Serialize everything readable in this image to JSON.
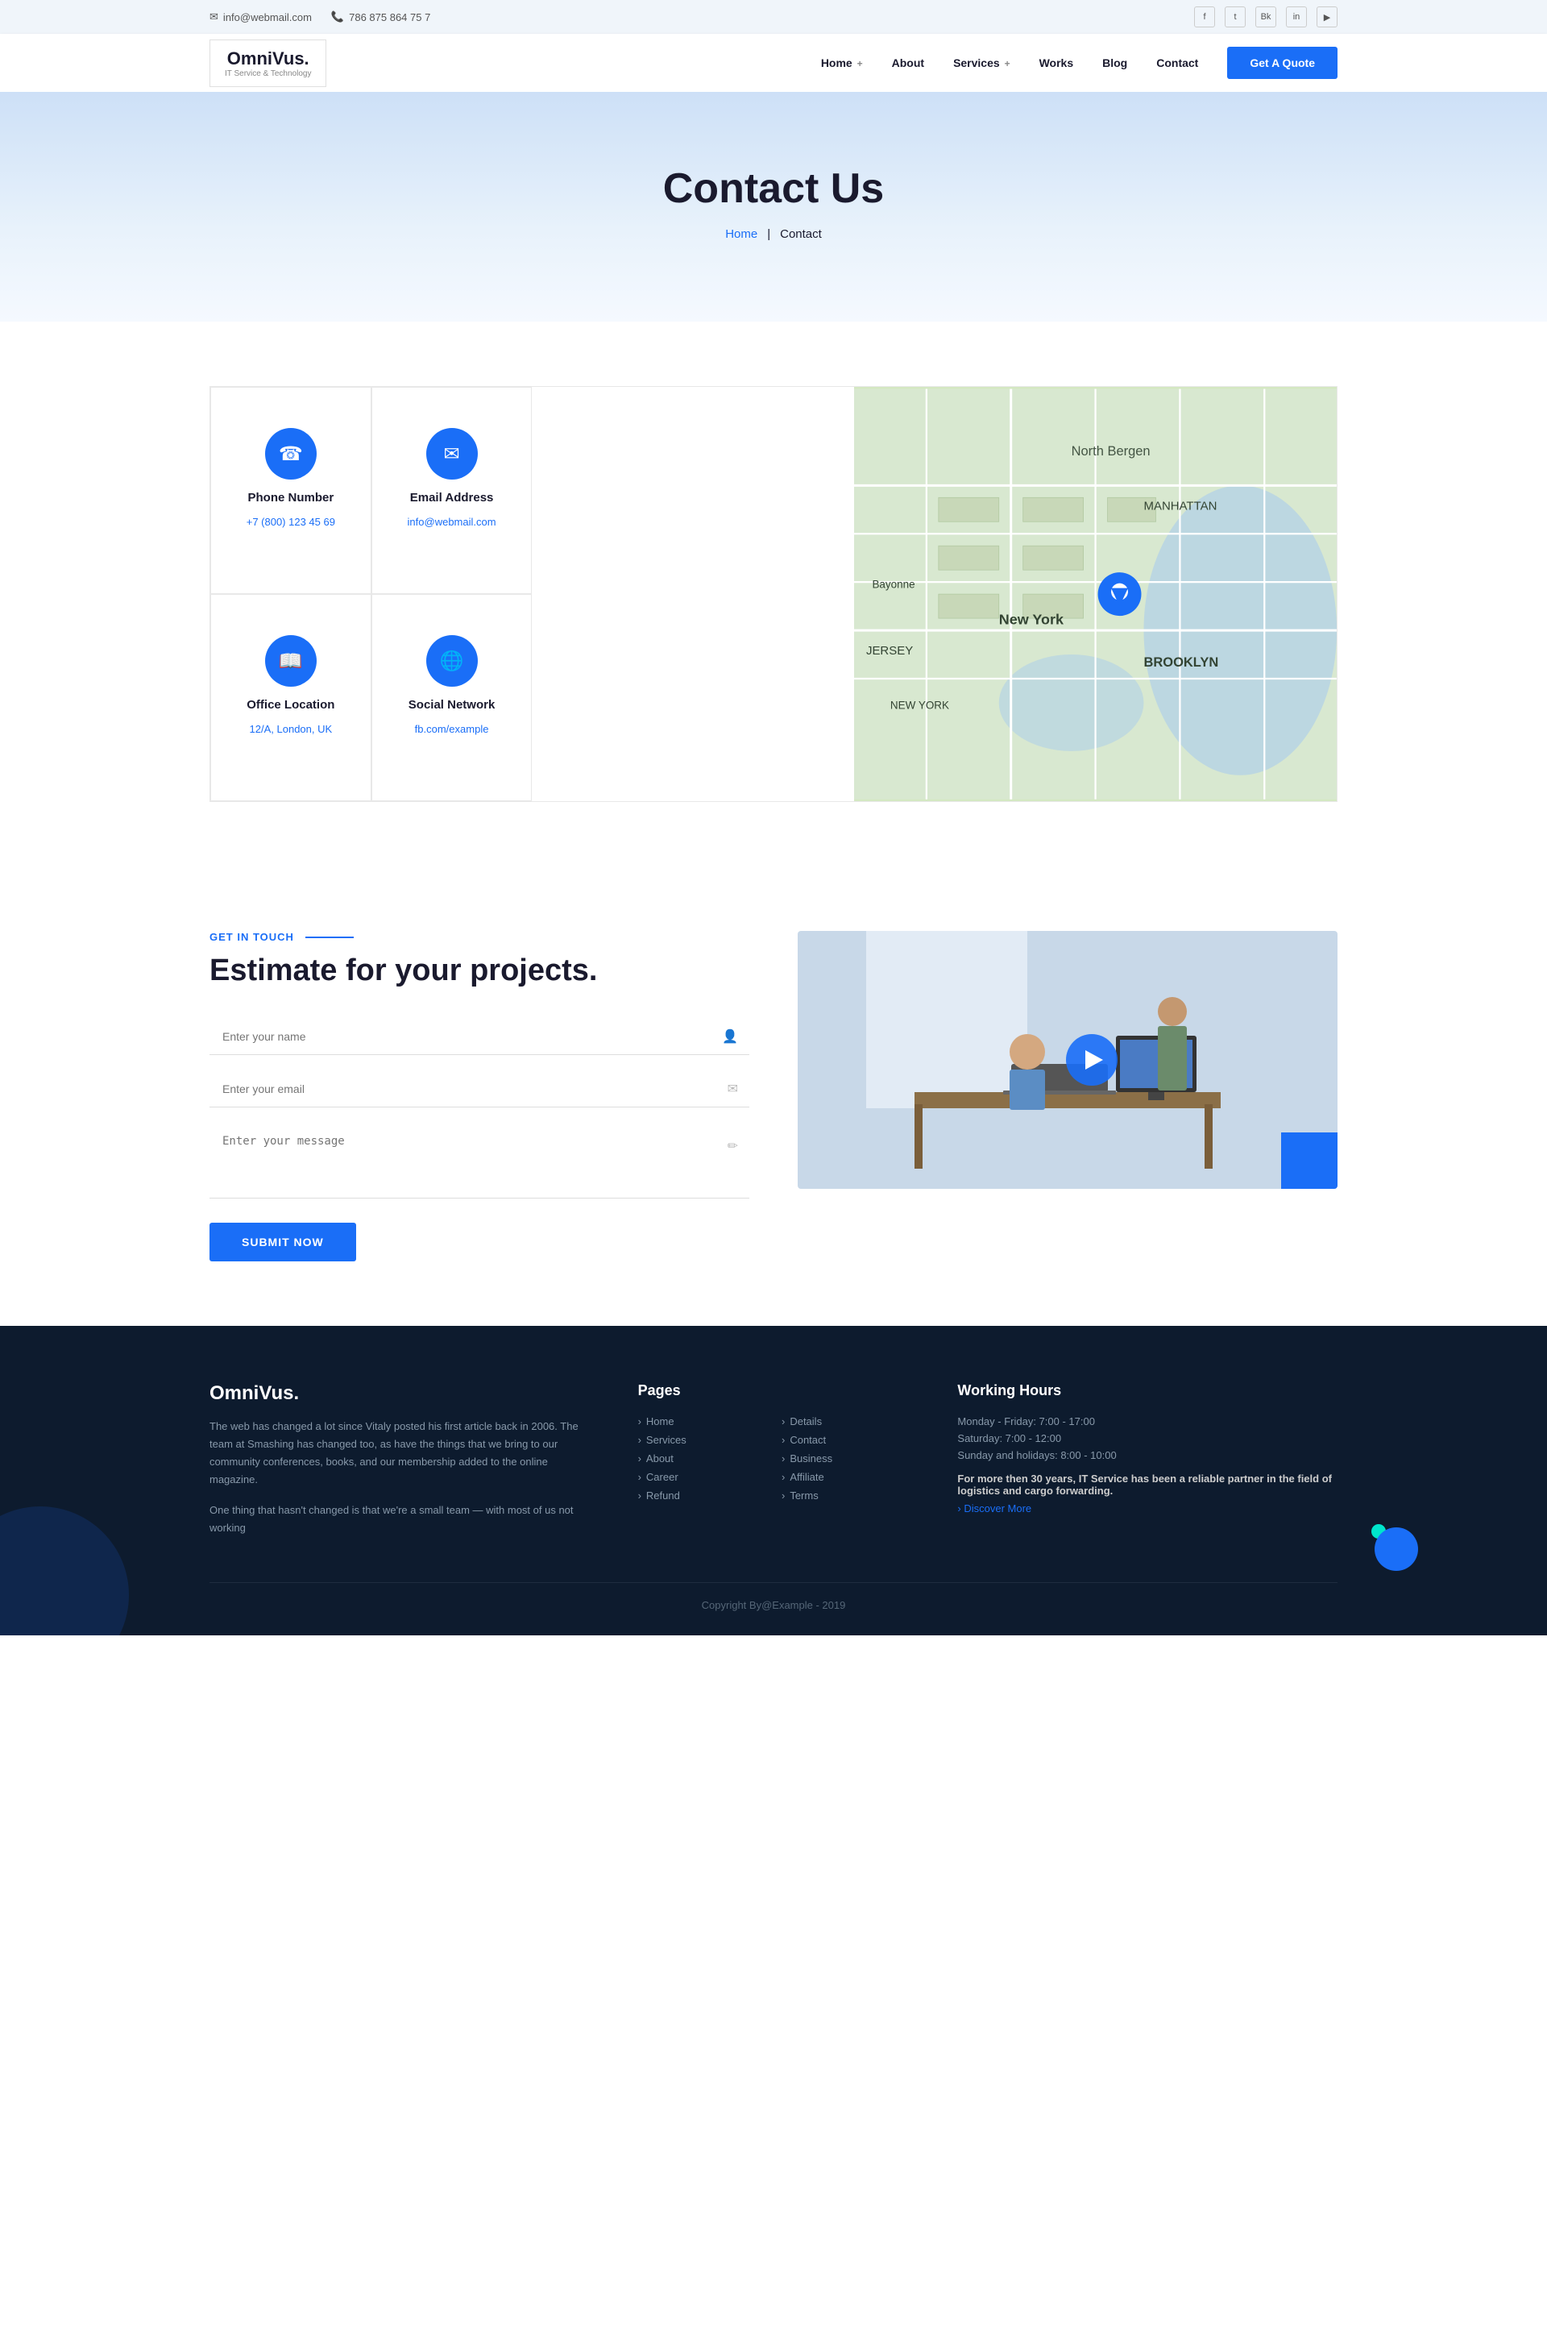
{
  "topbar": {
    "email_icon": "✉",
    "email": "info@webmail.com",
    "phone_icon": "📞",
    "phone": "786 875 864 75 7",
    "social": [
      "f",
      "t",
      "bk",
      "in",
      "▶"
    ]
  },
  "nav": {
    "logo_name": "OmniVus.",
    "logo_tagline": "IT Service & Technology",
    "links": [
      {
        "label": "Home",
        "has_plus": true
      },
      {
        "label": "About",
        "has_plus": false
      },
      {
        "label": "Services",
        "has_plus": true
      },
      {
        "label": "Works",
        "has_plus": false
      },
      {
        "label": "Blog",
        "has_plus": false
      },
      {
        "label": "Contact",
        "has_plus": false
      }
    ],
    "cta_label": "Get A Quote"
  },
  "hero": {
    "title": "Contact Us",
    "breadcrumb_home": "Home",
    "breadcrumb_sep": "|",
    "breadcrumb_current": "Contact"
  },
  "contact_cards": [
    {
      "icon": "☎",
      "title": "Phone Number",
      "value": "+7 (800) 123 45 69"
    },
    {
      "icon": "✉",
      "title": "Email Address",
      "value": "info@webmail.com"
    },
    {
      "icon": "📖",
      "title": "Office Location",
      "value": "12/A, London, UK"
    },
    {
      "icon": "🌐",
      "title": "Social Network",
      "value": "fb.com/example"
    }
  ],
  "estimate": {
    "tag": "Get In Touch",
    "title": "Estimate for your projects.",
    "name_placeholder": "Enter your name",
    "email_placeholder": "Enter your email",
    "message_placeholder": "Enter your message",
    "submit_label": "Submit Now"
  },
  "footer": {
    "brand_name": "OmniVus.",
    "description1": "The web has changed a lot since Vitaly posted his first article back in 2006. The team at Smashing has changed too, as have the things that we bring to our community conferences, books, and our membership added to the online magazine.",
    "description2": "One thing that hasn't changed is that we're a small team — with most of us not working",
    "pages_title": "Pages",
    "pages_col1": [
      "Home",
      "Services",
      "About",
      "Career",
      "Refund",
      "Terms"
    ],
    "pages_col2": [
      "Details",
      "Contact",
      "Business",
      "Affiliate"
    ],
    "hours_title": "Working Hours",
    "hours": [
      "Monday - Friday: 7:00 - 17:00",
      "Saturday: 7:00 - 12:00",
      "Sunday and holidays: 8:00 - 10:00"
    ],
    "hours_note_bold": "For more then 30 years,",
    "hours_note": " IT Service has been a reliable partner in the field of logistics and cargo forwarding.",
    "discover_label": "› Discover More",
    "copyright": "Copyright By@Example - 2019"
  }
}
